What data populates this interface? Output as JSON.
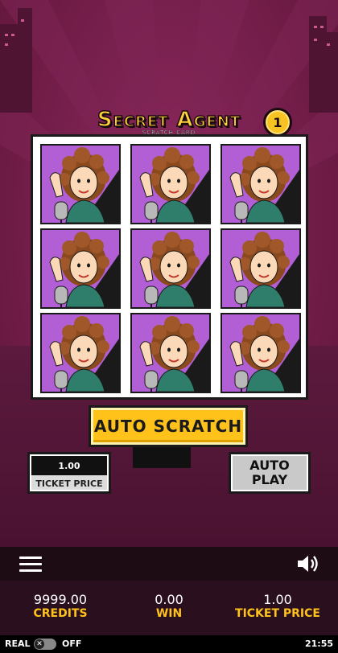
{
  "game": {
    "title": "Secret Agent",
    "subtitle": "SCRATCH CARD",
    "coin_value": "1"
  },
  "card": {
    "cells": [
      {
        "symbol": "singer-woman"
      },
      {
        "symbol": "singer-woman"
      },
      {
        "symbol": "singer-woman"
      },
      {
        "symbol": "singer-woman"
      },
      {
        "symbol": "singer-woman"
      },
      {
        "symbol": "singer-woman"
      },
      {
        "symbol": "singer-woman"
      },
      {
        "symbol": "singer-woman"
      },
      {
        "symbol": "singer-woman"
      }
    ]
  },
  "buttons": {
    "auto_scratch": "AUTO SCRATCH",
    "auto_play_line1": "AUTO",
    "auto_play_line2": "PLAY"
  },
  "ticket": {
    "value": "1.00",
    "label": "TICKET PRICE"
  },
  "stats": {
    "credits_value": "9999.00",
    "credits_label": "CREDITS",
    "win_value": "0.00",
    "win_label": "WIN",
    "ticket_value": "1.00",
    "ticket_label": "TICKET PRICE"
  },
  "status_bar": {
    "mode_label": "REAL",
    "toggle_glyph": "✕",
    "toggle_state": "OFF",
    "clock": "21:55"
  },
  "colors": {
    "background": "#6b1a44",
    "accent_yellow": "#ffc21a",
    "cell_purple": "#b25fd6"
  },
  "icons": {
    "menu": "hamburger-icon",
    "sound": "speaker-icon"
  }
}
